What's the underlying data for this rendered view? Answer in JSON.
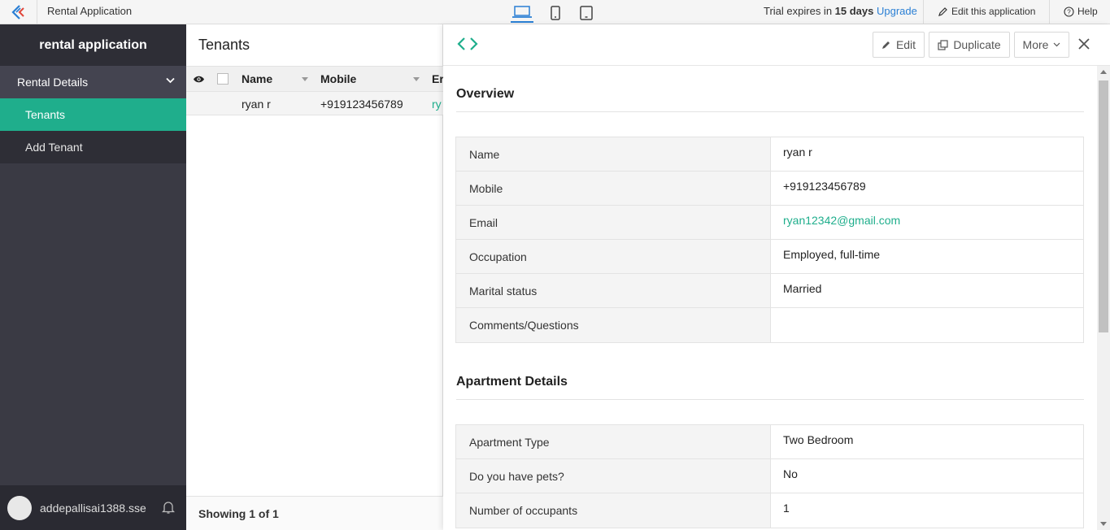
{
  "topbar": {
    "app_title": "Rental Application",
    "trial_prefix": "Trial expires in",
    "trial_days": "15 days",
    "upgrade": "Upgrade",
    "edit_app": "Edit this application",
    "help": "Help",
    "devices": [
      "laptop-icon",
      "phone-icon",
      "tablet-icon"
    ],
    "active_device": "laptop"
  },
  "sidebar": {
    "title": "rental application",
    "section": "Rental Details",
    "items": [
      {
        "label": "Tenants",
        "active": true
      },
      {
        "label": "Add Tenant",
        "active": false
      }
    ],
    "username": "addepallisai1388.sse"
  },
  "list": {
    "title": "Tenants",
    "columns": [
      "Name",
      "Mobile",
      "Er"
    ],
    "rows": [
      {
        "name": "ryan r",
        "mobile": "+919123456789",
        "email": "ry"
      }
    ],
    "footer": "Showing 1 of 1"
  },
  "detail": {
    "buttons": {
      "edit": "Edit",
      "duplicate": "Duplicate",
      "more": "More"
    },
    "overview": {
      "title": "Overview",
      "fields": [
        {
          "label": "Name",
          "value": "ryan r"
        },
        {
          "label": "Mobile",
          "value": "+919123456789"
        },
        {
          "label": "Email",
          "value": "ryan12342@gmail.com"
        },
        {
          "label": "Occupation",
          "value": "Employed, full-time"
        },
        {
          "label": "Marital status",
          "value": "Married"
        },
        {
          "label": "Comments/Questions",
          "value": ""
        }
      ]
    },
    "apartment": {
      "title": "Apartment Details",
      "fields": [
        {
          "label": "Apartment Type",
          "value": "Two Bedroom"
        },
        {
          "label": "Do you have pets?",
          "value": "No"
        },
        {
          "label": "Number of occupants",
          "value": "1"
        }
      ]
    }
  },
  "colors": {
    "accent": "#1fae8c",
    "link_blue": "#2a7fd4",
    "sidebar": "#3a3a44"
  }
}
